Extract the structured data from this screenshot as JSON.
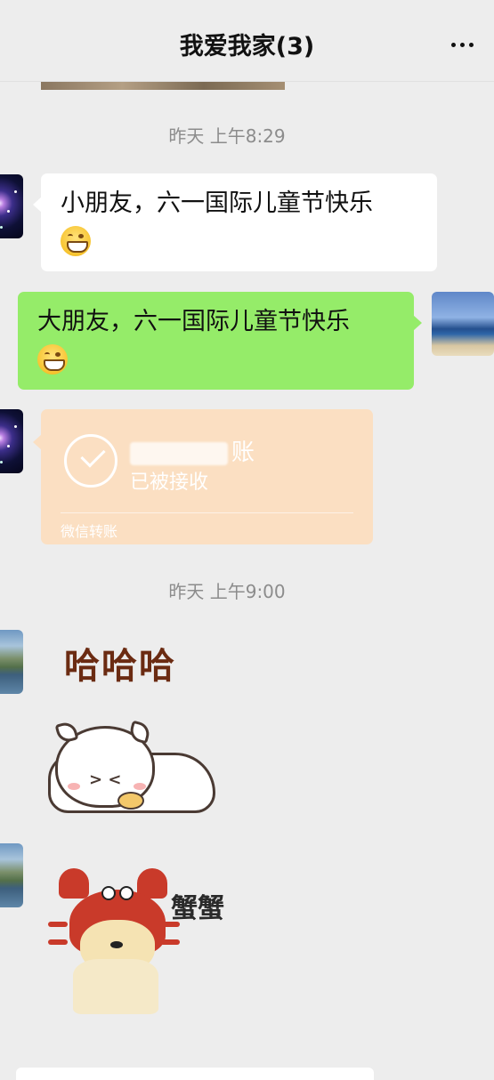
{
  "header": {
    "title": "我爱我家(3)",
    "more_icon": "more-dots-icon"
  },
  "messages": {
    "timestamp1": "昨天 上午8:29",
    "msg1": {
      "text": "小朋友，六一国际儿童节快乐",
      "emoji": "grin-emoji-icon"
    },
    "msg2": {
      "text": "大朋友，六一国际儿童节快乐",
      "emoji": "grin-emoji-icon"
    },
    "transfer": {
      "title_suffix": "账",
      "status": "已被接收",
      "footer": "微信转账"
    },
    "timestamp2": "昨天 上午9:00",
    "sticker1": {
      "text": "哈哈哈"
    },
    "sticker3": {
      "text": "蟹蟹"
    }
  },
  "colors": {
    "background": "#ededed",
    "bubble_out": "#95ec69",
    "bubble_in": "#ffffff",
    "transfer": "#fbdfc2"
  }
}
